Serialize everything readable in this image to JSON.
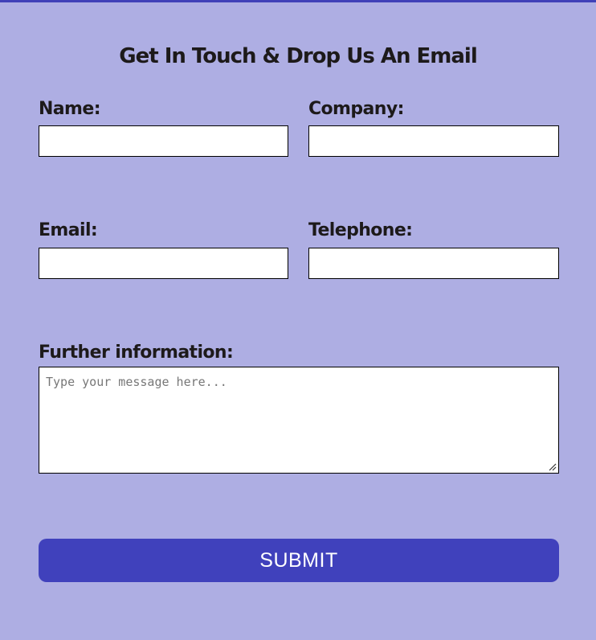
{
  "form": {
    "title": "Get In Touch & Drop Us An Email",
    "fields": {
      "name": {
        "label": "Name:",
        "value": ""
      },
      "company": {
        "label": "Company:",
        "value": ""
      },
      "email": {
        "label": "Email:",
        "value": ""
      },
      "telephone": {
        "label": "Telephone:",
        "value": ""
      },
      "further_information": {
        "label": "Further information:",
        "value": "",
        "placeholder": "Type your message here..."
      }
    },
    "submit_label": "SUBMIT"
  },
  "colors": {
    "background": "#aeaee3",
    "accent": "#4041bc",
    "text": "#1d1a1a",
    "button_text": "#ffffff"
  }
}
